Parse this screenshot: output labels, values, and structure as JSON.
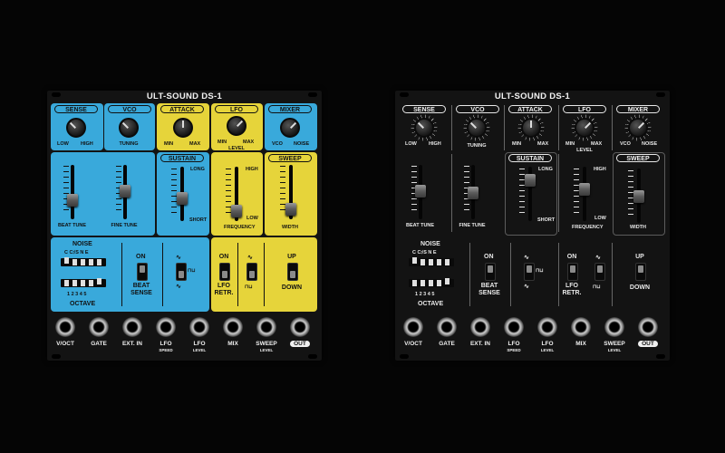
{
  "panel_title": "ULT-SOUND DS-1",
  "colors": {
    "blue": "#39a9db",
    "yellow": "#e6d43a",
    "background": "#050505"
  },
  "sections": {
    "sense": "SENSE",
    "vco": "VCO",
    "attack": "ATTACK",
    "lfo": "LFO",
    "mixer": "MIXER",
    "sustain": "SUSTAIN",
    "sweep": "SWEEP"
  },
  "knob_labels": {
    "sense_low": "LOW",
    "sense_high": "HIGH",
    "vco_tuning": "TUNING",
    "attack_min": "MIN",
    "attack_max": "MAX",
    "lfo_min": "MIN",
    "lfo_max": "MAX",
    "lfo_level": "LEVEL",
    "mixer_vco": "VCO",
    "mixer_noise": "NOISE"
  },
  "slider_labels": {
    "beat_tune": "BEAT TUNE",
    "fine_tune": "FINE TUNE",
    "sustain_long": "LONG",
    "sustain_short": "SHORT",
    "freq_high": "HIGH",
    "freq_low": "LOW",
    "frequency": "FREQUENCY",
    "width": "WIDTH"
  },
  "switches": {
    "noise": "NOISE",
    "notes": "C C♯S N E",
    "octave_nums": "1 2 3 4 5",
    "octave": "OCTAVE",
    "beat_on": "ON",
    "beat_sense": "BEAT SENSE",
    "lfo_on": "ON",
    "lfo_retr": "LFO RETR.",
    "wave_sine": "∿",
    "wave_square": "⊓⊔",
    "up": "UP",
    "down": "DOWN"
  },
  "jacks": [
    {
      "label": "V/OCT",
      "sub": ""
    },
    {
      "label": "GATE",
      "sub": ""
    },
    {
      "label": "EXT. IN",
      "sub": ""
    },
    {
      "label": "LFO",
      "sub": "SPEED"
    },
    {
      "label": "LFO",
      "sub": "LEVEL"
    },
    {
      "label": "MIX",
      "sub": ""
    },
    {
      "label": "SWEEP",
      "sub": "LEVEL"
    },
    {
      "label": "OUT",
      "sub": ""
    }
  ]
}
